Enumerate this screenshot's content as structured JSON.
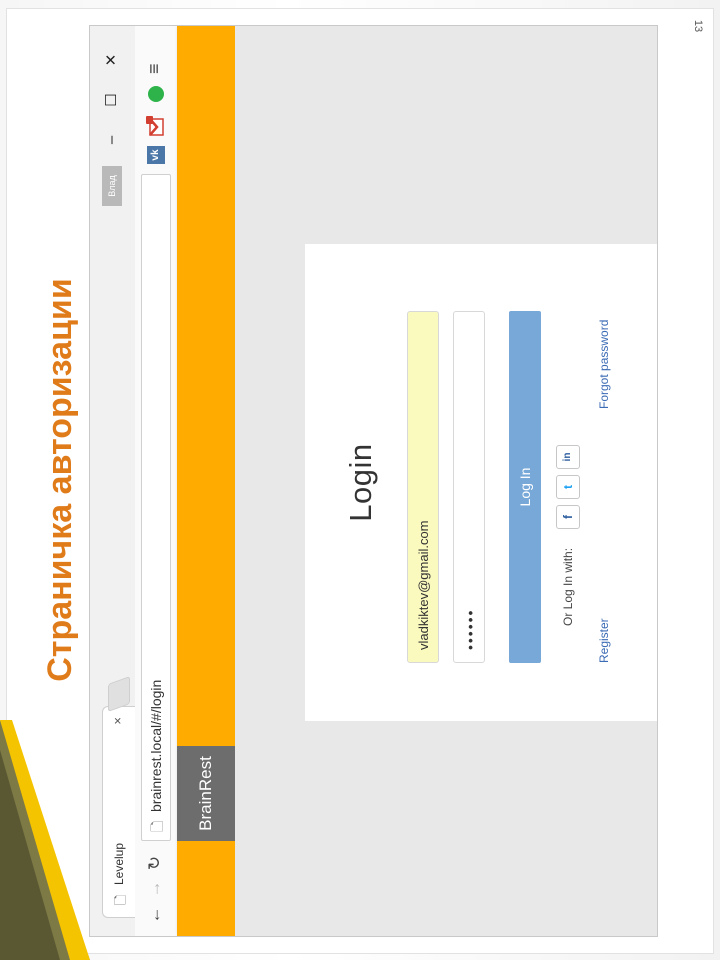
{
  "slide": {
    "title": "Страничка авторизации",
    "page_number": "13"
  },
  "browser": {
    "tab_title": "Levelup",
    "tab_icon": "page-icon",
    "tab_close": "×",
    "profile_name": "Влад",
    "window_controls": {
      "minimize": "–",
      "maximize": "☐",
      "close": "✕"
    },
    "url": "brainrest.local/#/login",
    "extensions": [
      "vk-icon",
      "gmail-icon",
      "green-dot-icon"
    ],
    "menu_icon": "menu-icon",
    "vk_label": "vk"
  },
  "site": {
    "brand": "BrainRest",
    "header_color": "#ffab00"
  },
  "login": {
    "title": "Login",
    "email_value": "vladkiktev@gmail.com",
    "password_value": "••••••",
    "login_button": "Log In",
    "social_label": "Or Log In with:",
    "social_icons": {
      "facebook": "f",
      "twitter": "t",
      "linkedin": "in"
    },
    "register_link": "Register",
    "forgot_link": "Forgot password",
    "button_color": "#78a8d8"
  }
}
